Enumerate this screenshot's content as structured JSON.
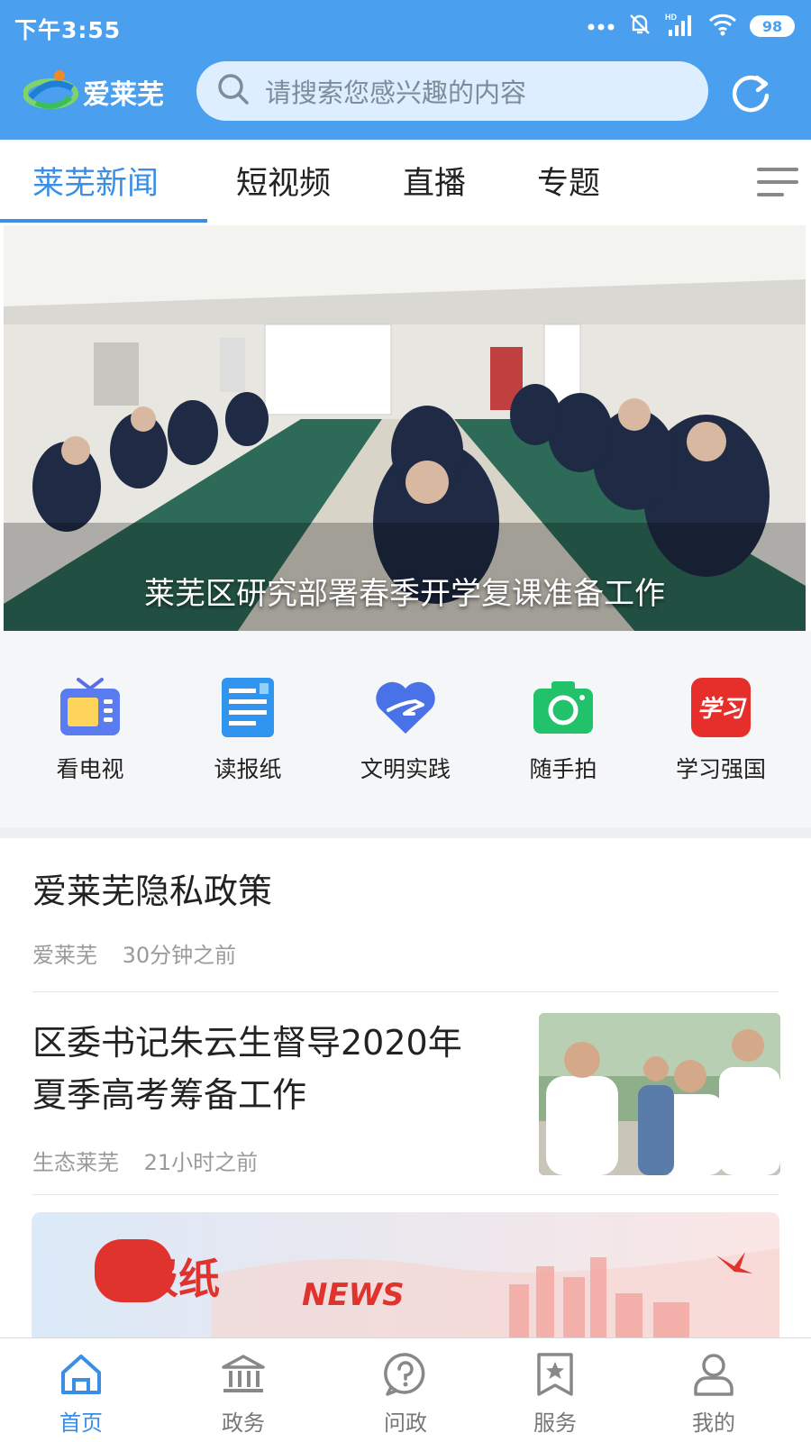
{
  "status_bar": {
    "time": "下午3:55",
    "battery": "98",
    "network": "HD"
  },
  "header": {
    "app_name": "爱莱芜",
    "search_placeholder": "请搜索您感兴趣的内容",
    "refresh_icon": "refresh-icon",
    "accent_color": "#4aa0ee"
  },
  "tabs": [
    {
      "label": "莱芜新闻",
      "active": true
    },
    {
      "label": "短视频",
      "active": false
    },
    {
      "label": "直播",
      "active": false
    },
    {
      "label": "专题",
      "active": false
    }
  ],
  "banner": {
    "caption": "莱芜区研究部署春季开学复课准备工作"
  },
  "quick_links": [
    {
      "label": "看电视",
      "icon": "tv-icon"
    },
    {
      "label": "读报纸",
      "icon": "newspaper-icon"
    },
    {
      "label": "文明实践",
      "icon": "heart-hand-icon"
    },
    {
      "label": "随手拍",
      "icon": "camera-icon"
    },
    {
      "label": "学习强国",
      "icon": "xuexi-icon",
      "icon_text": "学习"
    }
  ],
  "news": [
    {
      "title": "爱莱芜隐私政策",
      "source": "爱莱芜",
      "time": "30分钟之前"
    },
    {
      "title_line1": "区委书记朱云生督导2020年",
      "title_line2": "夏季高考筹备工作",
      "source": "生态莱芜",
      "time": "21小时之前"
    }
  ],
  "promo": {
    "title": "看报纸",
    "subtitle": "NEWS"
  },
  "bottom_nav": [
    {
      "label": "首页",
      "icon": "home-icon",
      "active": true
    },
    {
      "label": "政务",
      "icon": "government-icon",
      "active": false
    },
    {
      "label": "问政",
      "icon": "question-icon",
      "active": false
    },
    {
      "label": "服务",
      "icon": "bookmark-star-icon",
      "active": false
    },
    {
      "label": "我的",
      "icon": "user-icon",
      "active": false
    }
  ]
}
